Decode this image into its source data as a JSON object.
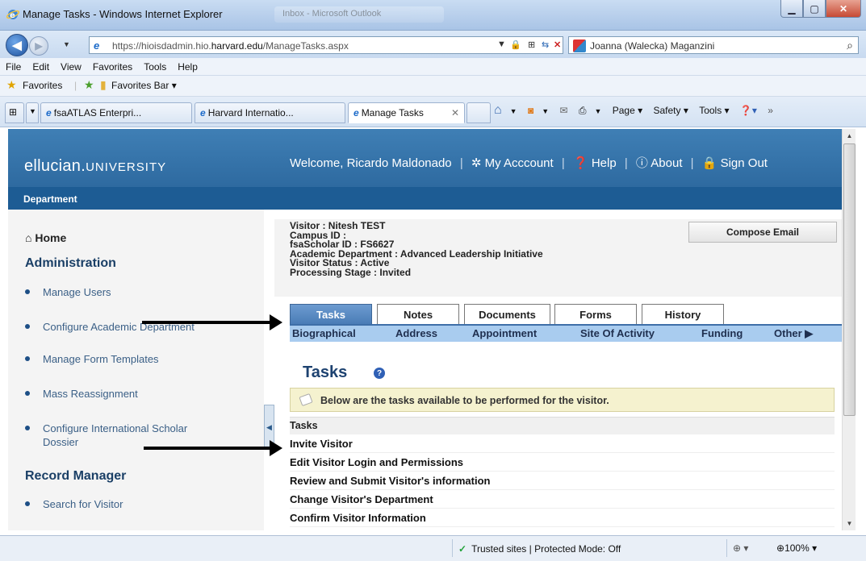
{
  "window": {
    "title": "Manage Tasks - Windows Internet Explorer",
    "background_tab": "Inbox - Microsoft Outlook"
  },
  "address": {
    "url_prefix": "https://hioisdadmin.hio.",
    "url_domain": "harvard.edu",
    "url_path": "/ManageTasks.aspx",
    "search_text": "Joanna (Walecka) Maganzini"
  },
  "menu": [
    "File",
    "Edit",
    "View",
    "Favorites",
    "Tools",
    "Help"
  ],
  "favorites": {
    "label": "Favorites",
    "bar_label": "Favorites Bar ▾"
  },
  "tabs": [
    {
      "label": "fsaATLAS Enterpri..."
    },
    {
      "label": "Harvard Internatio..."
    },
    {
      "label": "Manage Tasks"
    }
  ],
  "commandbar": [
    "Page ▾",
    "Safety ▾",
    "Tools ▾"
  ],
  "site": {
    "logo_main": "ellucian.",
    "logo_sub": "UNIVERSITY",
    "welcome": "Welcome, Ricardo Maldonado",
    "my_account": "My Acccount",
    "help": "Help",
    "about": "About",
    "sign_out": "Sign Out",
    "dept_bar": "Department"
  },
  "sidebar": {
    "home": "Home",
    "admin_heading": "Administration",
    "admin_items": [
      "Manage Users",
      "Configure Academic Department",
      "Manage Form Templates",
      "Mass Reassignment",
      "Configure International Scholar Dossier"
    ],
    "record_heading": "Record Manager",
    "record_items": [
      "Search for Visitor"
    ]
  },
  "visitor": {
    "line1": "Visitor : Nitesh TEST",
    "line2": "Campus ID :",
    "line3": "fsaScholar ID : FS6627",
    "line4": "Academic Department : Advanced Leadership Initiative",
    "line5": "Visitor Status : Active",
    "line6": "Processing Stage : Invited",
    "compose": "Compose Email"
  },
  "main_tabs": [
    "Tasks",
    "Notes",
    "Documents",
    "Forms",
    "History"
  ],
  "sub_tabs": [
    "Biographical",
    "Address",
    "Appointment",
    "Site Of Activity",
    "Funding",
    "Other ▶"
  ],
  "tasks": {
    "title": "Tasks",
    "info": "Below are the tasks available to be performed for the visitor.",
    "header": "Tasks",
    "rows": [
      "Invite Visitor",
      "Edit Visitor Login and Permissions",
      "Review and Submit Visitor's information",
      "Change Visitor's Department",
      "Confirm Visitor Information"
    ]
  },
  "status": {
    "zone": "Trusted sites | Protected Mode: Off",
    "zoom": "100%"
  },
  "colors": {
    "header_blue": "#2e6aa0",
    "dept_bar": "#1d5c94",
    "active_tab": "#4a7cb6",
    "subtab_bg": "#a9ccef",
    "infobar_bg": "#f5f2cf"
  }
}
